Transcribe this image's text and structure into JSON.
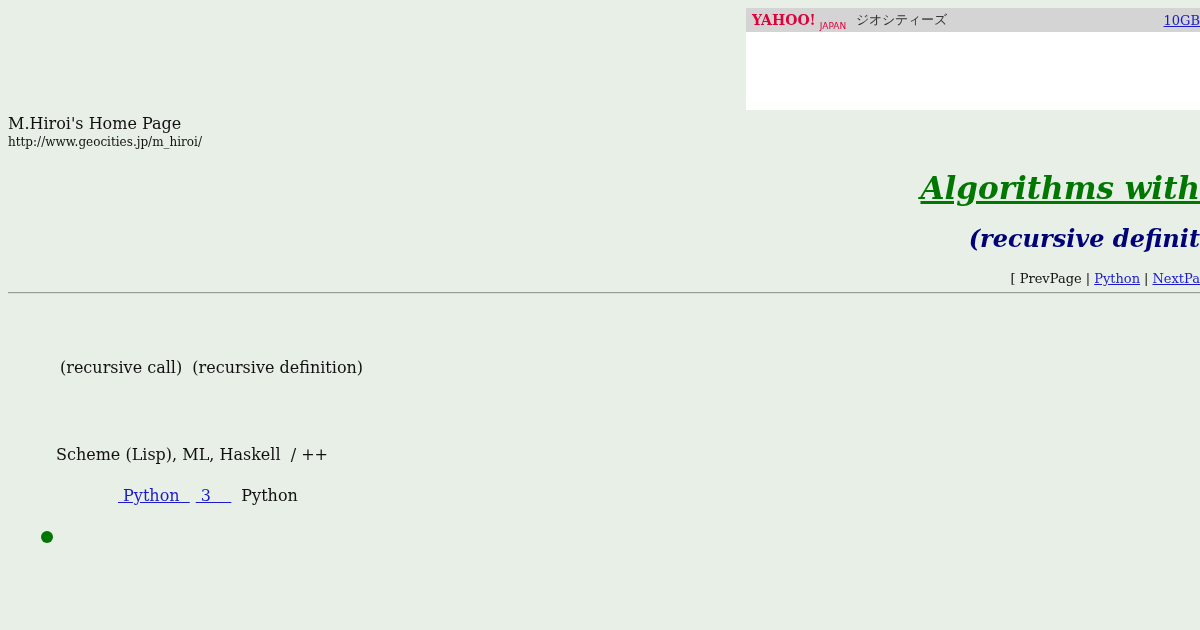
{
  "banner": {
    "logo": "YAHOO!",
    "logo_sub": "JAPAN",
    "service": "ジオシティーズ",
    "link": "10GB"
  },
  "site": {
    "title": "M.Hiroi's Home Page",
    "url": "http://www.geocities.jp/m_hiroi/"
  },
  "heading": {
    "title": "Algorithms with",
    "subtitle": "(recursive definit"
  },
  "nav": [
    {
      "text": "[ PrevPage |",
      "kind": "text"
    },
    {
      "text": "Python",
      "kind": "link"
    },
    {
      "text": "|",
      "kind": "text"
    },
    {
      "text": "NextPa",
      "kind": "link"
    }
  ],
  "intro": "(recursive call)  (recursive definition)",
  "languages": "Scheme (Lisp), ML, Haskell  / ++",
  "refs": [
    {
      "text": " Python  ",
      "kind": "link"
    },
    {
      "text": " 3    ",
      "kind": "link"
    },
    {
      "text": "Python",
      "kind": "text"
    }
  ],
  "bullet": {
    "color": "#007700"
  }
}
